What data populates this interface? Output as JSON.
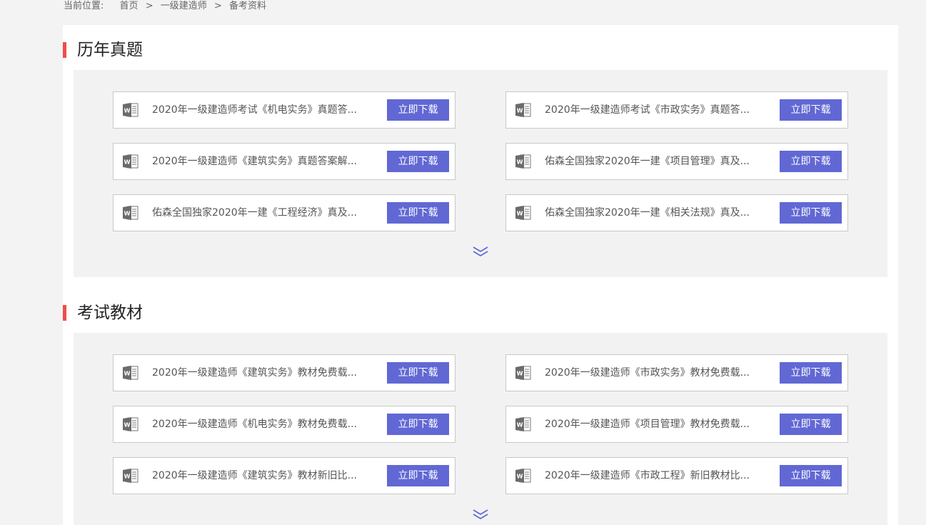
{
  "breadcrumb": {
    "prefix": "当前位置:",
    "items": [
      "首页",
      "一级建造师",
      "备考资料"
    ],
    "separator": ">"
  },
  "accent_color": "#ef4c4c",
  "button_color": "#6168d4",
  "sections": [
    {
      "title": "历年真题",
      "files": [
        {
          "title": "2020年一级建造师考试《机电实务》真题答...",
          "icon": "word-doc-icon",
          "button": "立即下载"
        },
        {
          "title": "2020年一级建造师考试《市政实务》真题答...",
          "icon": "word-doc-icon",
          "button": "立即下载"
        },
        {
          "title": "2020年一级建造师《建筑实务》真题答案解...",
          "icon": "word-doc-icon",
          "button": "立即下载"
        },
        {
          "title": "佑森全国独家2020年一建《项目管理》真及...",
          "icon": "word-doc-icon",
          "button": "立即下载"
        },
        {
          "title": "佑森全国独家2020年一建《工程经济》真及...",
          "icon": "word-doc-icon",
          "button": "立即下载"
        },
        {
          "title": "佑森全国独家2020年一建《相关法规》真及...",
          "icon": "word-doc-icon",
          "button": "立即下载"
        }
      ],
      "more_icon": "chevron-double-down-icon"
    },
    {
      "title": "考试教材",
      "files": [
        {
          "title": "2020年一级建造师《建筑实务》教材免费载...",
          "icon": "word-doc-icon",
          "button": "立即下载"
        },
        {
          "title": "2020年一级建造师《市政实务》教材免费载...",
          "icon": "word-doc-icon",
          "button": "立即下载"
        },
        {
          "title": "2020年一级建造师《机电实务》教材免费载...",
          "icon": "word-doc-icon",
          "button": "立即下载"
        },
        {
          "title": "2020年一级建造师《项目管理》教材免费载...",
          "icon": "word-doc-icon",
          "button": "立即下载"
        },
        {
          "title": "2020年一级建造师《建筑实务》教材新旧比...",
          "icon": "word-doc-icon",
          "button": "立即下载"
        },
        {
          "title": "2020年一级建造师《市政工程》新旧教材比...",
          "icon": "word-doc-icon",
          "button": "立即下载"
        }
      ],
      "more_icon": "chevron-double-down-icon"
    }
  ]
}
